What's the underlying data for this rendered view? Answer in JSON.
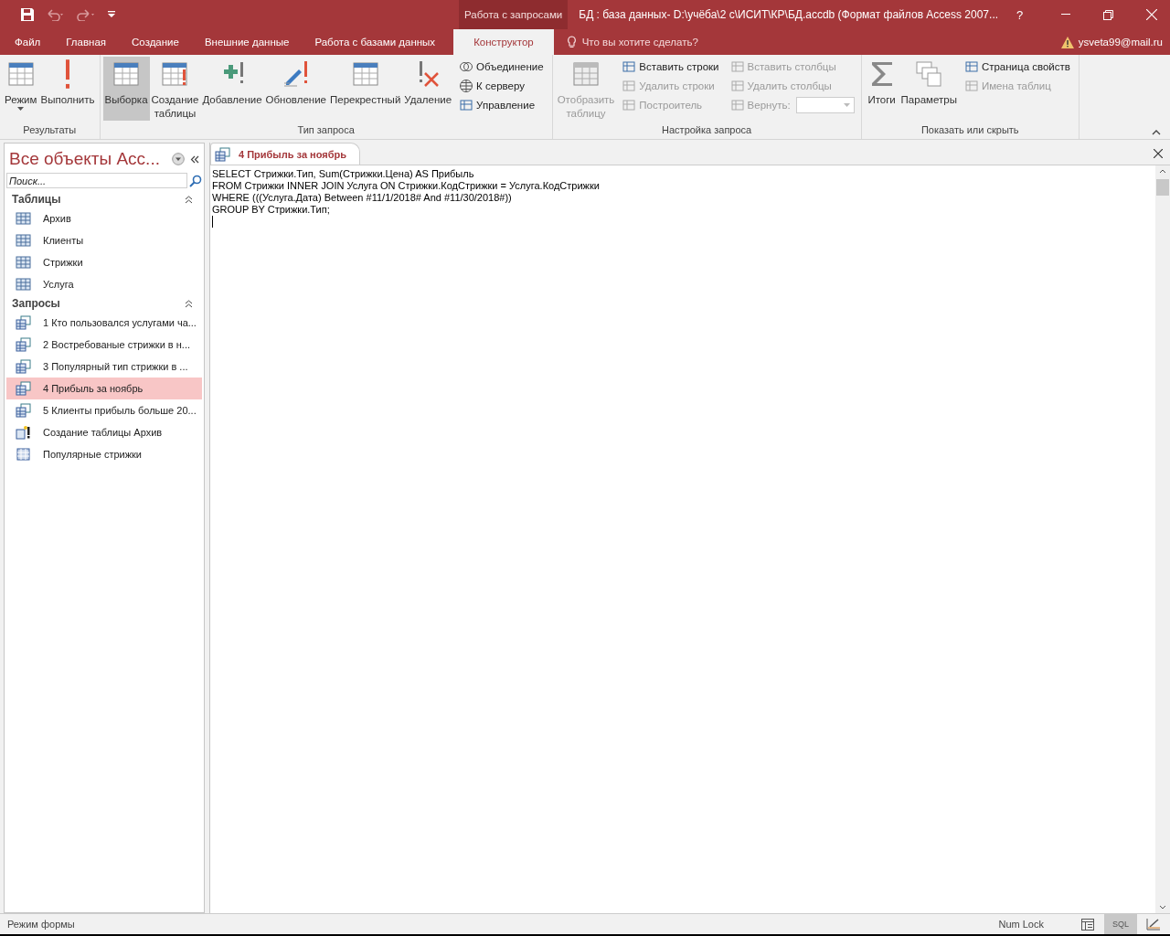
{
  "title_bar": {
    "context_label": "Работа с запросами",
    "title": "БД : база данных- D:\\учёба\\2 с\\ИСИТ\\КР\\БД.accdb (Формат файлов Access 2007...",
    "help": "?"
  },
  "ribbon_tabs": [
    {
      "label": "Файл",
      "selected": false
    },
    {
      "label": "Главная",
      "selected": false
    },
    {
      "label": "Создание",
      "selected": false
    },
    {
      "label": "Внешние данные",
      "selected": false
    },
    {
      "label": "Работа с базами данных",
      "selected": false
    },
    {
      "label": "Конструктор",
      "selected": true
    }
  ],
  "tell_me": {
    "placeholder": "Что вы хотите сделать?"
  },
  "account": "ysveta99@mail.ru",
  "ribbon_groups": [
    {
      "label": "Результаты",
      "items": [
        {
          "kind": "large",
          "label": "Режим",
          "dropdown": true,
          "disabled": false,
          "selected": false
        },
        {
          "kind": "large",
          "label": "Выполнить",
          "disabled": false,
          "selected": false
        }
      ]
    },
    {
      "label": "Тип запроса",
      "items": [
        {
          "kind": "large",
          "label": "Выборка",
          "disabled": false,
          "selected": true
        },
        {
          "kind": "large",
          "label": "Создание таблицы",
          "disabled": false,
          "selected": false
        },
        {
          "kind": "large",
          "label": "Добавление",
          "disabled": false,
          "selected": false
        },
        {
          "kind": "large",
          "label": "Обновление",
          "disabled": false,
          "selected": false
        },
        {
          "kind": "large",
          "label": "Перекрестный",
          "disabled": false,
          "selected": false
        },
        {
          "kind": "large",
          "label": "Удаление",
          "disabled": false,
          "selected": false
        },
        {
          "kind": "stack",
          "items": [
            {
              "label": "Объединение",
              "disabled": false
            },
            {
              "label": "К серверу",
              "disabled": false
            },
            {
              "label": "Управление",
              "disabled": false
            }
          ]
        }
      ]
    },
    {
      "label": "Настройка запроса",
      "items": [
        {
          "kind": "large",
          "label": "Отобразить таблицу",
          "disabled": true,
          "selected": false
        },
        {
          "kind": "stack",
          "items": [
            {
              "label": "Вставить строки",
              "disabled": false
            },
            {
              "label": "Удалить строки",
              "disabled": true
            },
            {
              "label": "Построитель",
              "disabled": true
            }
          ]
        },
        {
          "kind": "stack",
          "items": [
            {
              "label": "Вставить столбцы",
              "disabled": true
            },
            {
              "label": "Удалить столбцы",
              "disabled": true
            },
            {
              "label": "Вернуть:",
              "disabled": true,
              "combo": true
            }
          ]
        }
      ]
    },
    {
      "label": "Показать или скрыть",
      "items": [
        {
          "kind": "large",
          "label": "Итоги",
          "disabled": false,
          "selected": false
        },
        {
          "kind": "large",
          "label": "Параметры",
          "disabled": false,
          "selected": false
        },
        {
          "kind": "stack",
          "items": [
            {
              "label": "Страница свойств",
              "disabled": false
            },
            {
              "label": "Имена таблиц",
              "disabled": true
            }
          ]
        }
      ]
    }
  ],
  "nav_pane": {
    "title": "Все объекты Acc...",
    "search": {
      "placeholder": "Поиск..."
    },
    "sections": [
      {
        "label": "Таблицы",
        "expanded": true,
        "items": [
          {
            "kind": "table",
            "label": "Архив",
            "selected": false
          },
          {
            "kind": "table",
            "label": "Клиенты",
            "selected": false
          },
          {
            "kind": "table",
            "label": "Стрижки",
            "selected": false
          },
          {
            "kind": "table",
            "label": "Услуга",
            "selected": false
          }
        ]
      },
      {
        "label": "Запросы",
        "expanded": true,
        "items": [
          {
            "kind": "select",
            "label": "1 Кто пользовался услугами ча...",
            "selected": false
          },
          {
            "kind": "select",
            "label": "2 Востребованые стрижки в н...",
            "selected": false
          },
          {
            "kind": "select",
            "label": "3 Популярный тип стрижки в ...",
            "selected": false
          },
          {
            "kind": "select",
            "label": "4 Прибыль за ноябрь",
            "selected": true
          },
          {
            "kind": "select",
            "label": "5 Клиенты прибыль больше 20...",
            "selected": false
          },
          {
            "kind": "make_table",
            "label": "Создание таблицы Архив",
            "selected": false
          },
          {
            "kind": "crosstab",
            "label": "Популярные стрижки",
            "selected": false
          }
        ]
      }
    ]
  },
  "document_tabs": [
    {
      "label": "4 Прибыль за ноябрь",
      "selected": true
    }
  ],
  "sql_lines": [
    "SELECT Стрижки.Тип, Sum(Стрижки.Цена) AS Прибыль",
    "FROM Стрижки INNER JOIN Услуга ON Стрижки.КодСтрижки = Услуга.КодСтрижки",
    "WHERE (((Услуга.Дата) Between #11/1/2018# And #11/30/2018#))",
    "GROUP BY Стрижки.Тип;"
  ],
  "status_bar": {
    "mode": "Режим формы",
    "num_lock": "Num Lock",
    "views": [
      {
        "kind": "datasheet",
        "selected": false
      },
      {
        "kind": "sql",
        "label": "SQL",
        "selected": true
      },
      {
        "kind": "design",
        "selected": false
      }
    ]
  }
}
